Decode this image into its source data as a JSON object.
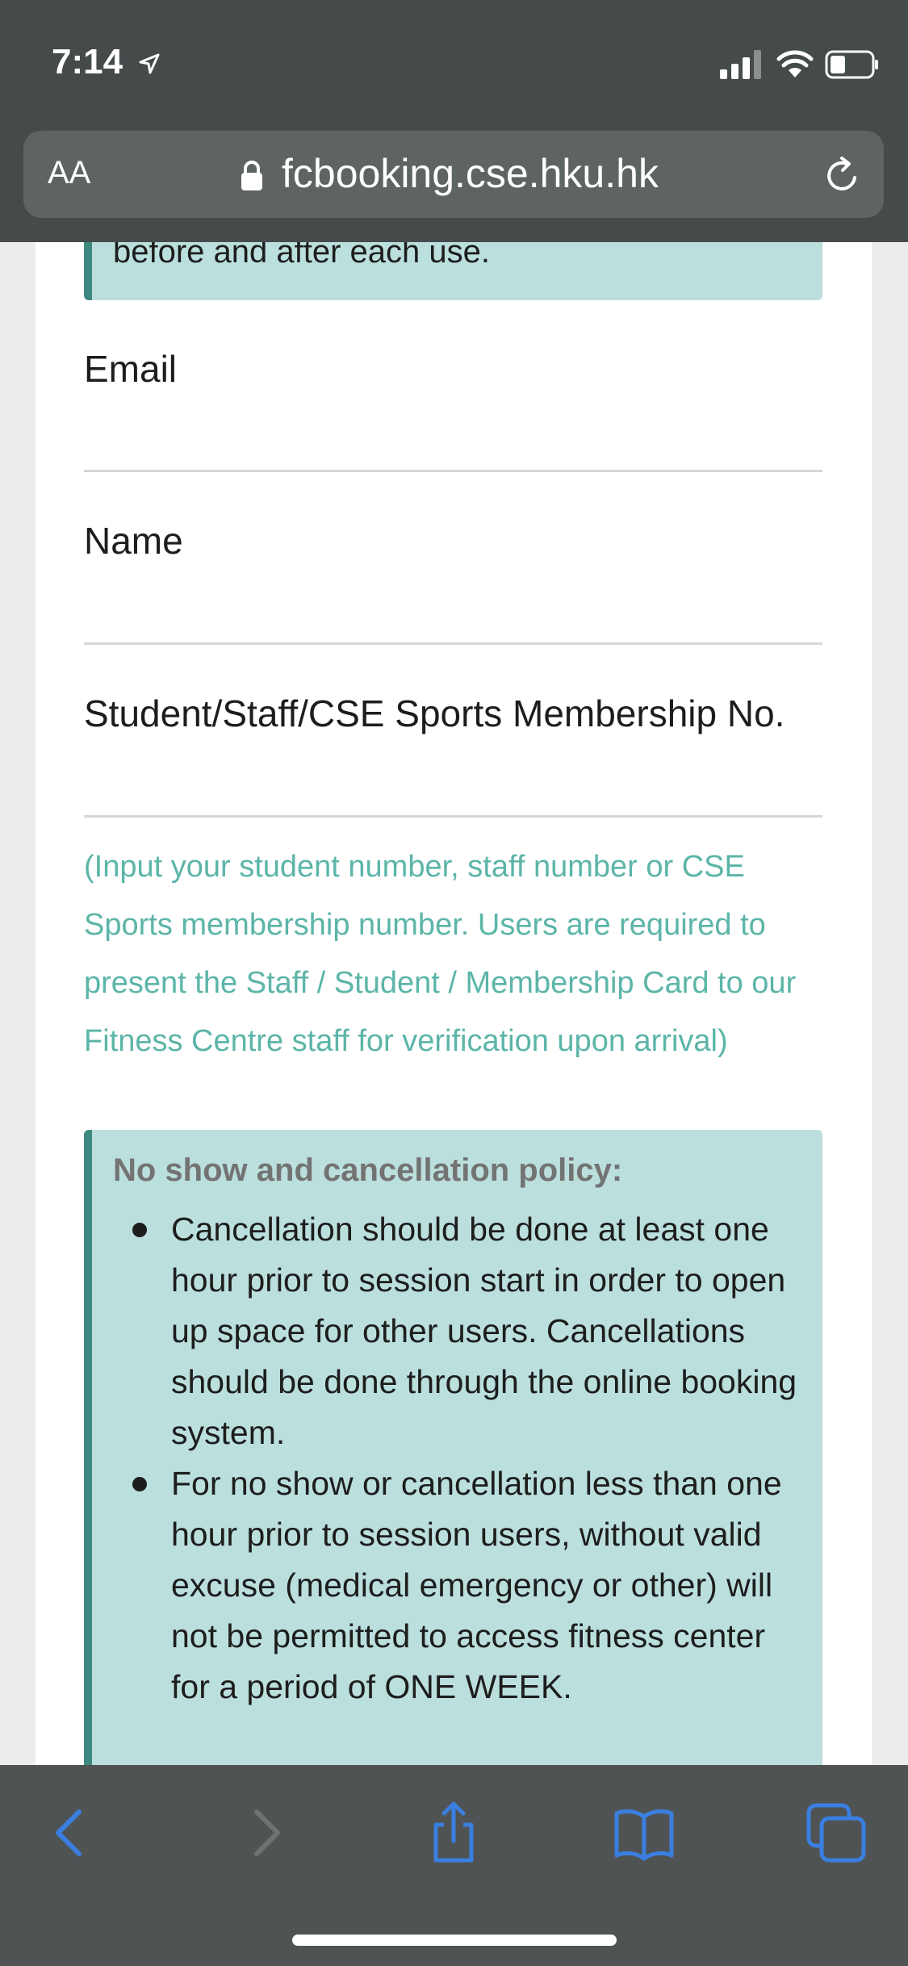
{
  "status_bar": {
    "time": "7:14"
  },
  "browser": {
    "text_size_label": "AA",
    "url": "fcbooking.cse.hku.hk"
  },
  "form": {
    "top_notice": "before and after each use.",
    "email_label": "Email",
    "name_label": "Name",
    "membership_label": "Student/Staff/CSE Sports Membership No.",
    "membership_help": "(Input your student number, staff number or CSE Sports membership number. Users are required to present the Staff / Student / Membership Card to our Fitness Centre staff for verification upon arrival)",
    "policy": {
      "title": "No show and cancellation policy:",
      "items": [
        "Cancellation should be done at least one hour prior to session start in order to open up space for other users. Cancellations should be done through the online booking system.",
        "For no show or cancellation less than one hour prior to session users, without valid excuse (medical emergency or other) will not be permitted to access fitness center for a period of ONE WEEK."
      ]
    }
  },
  "toolbar": {
    "icons": [
      "back-icon",
      "forward-icon",
      "share-icon",
      "bookmarks-icon",
      "tabs-icon"
    ]
  },
  "colors": {
    "chrome": "#454a4b",
    "alert_bg": "#bbdfdd",
    "alert_border": "#3e8a80",
    "help_text": "#5cb5a8",
    "link_blue": "#3a7fe0"
  }
}
